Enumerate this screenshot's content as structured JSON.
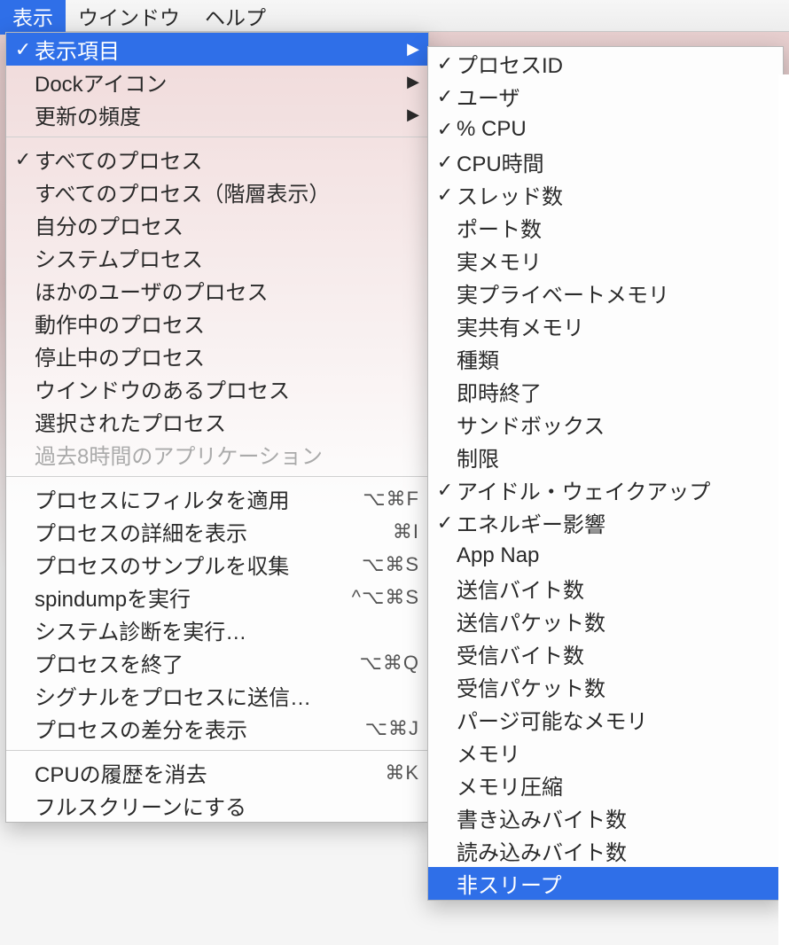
{
  "menubar": {
    "view": "表示",
    "window": "ウインドウ",
    "help": "ヘルプ"
  },
  "main_menu": {
    "columns": "表示項目",
    "dock_icon": "Dockアイコン",
    "update_frequency": "更新の頻度",
    "all_processes": "すべてのプロセス",
    "all_processes_hier": "すべてのプロセス（階層表示）",
    "my_processes": "自分のプロセス",
    "system_processes": "システムプロセス",
    "other_user_processes": "ほかのユーザのプロセス",
    "active_processes": "動作中のプロセス",
    "inactive_processes": "停止中のプロセス",
    "windowed_processes": "ウインドウのあるプロセス",
    "selected_processes": "選択されたプロセス",
    "apps_last_8h": "過去8時間のアプリケーション",
    "filter_processes": "プロセスにフィルタを適用",
    "inspect_process": "プロセスの詳細を表示",
    "sample_process": "プロセスのサンプルを収集",
    "run_spindump": "spindumpを実行",
    "run_sysdiagnose": "システム診断を実行…",
    "quit_process": "プロセスを終了",
    "send_signal": "シグナルをプロセスに送信…",
    "show_deltas": "プロセスの差分を表示",
    "clear_cpu_history": "CPUの履歴を消去",
    "enter_full_screen": "フルスクリーンにする"
  },
  "shortcuts": {
    "filter": "⌥⌘F",
    "inspect": "⌘I",
    "sample": "⌥⌘S",
    "spindump": "^⌥⌘S",
    "quit": "⌥⌘Q",
    "deltas": "⌥⌘J",
    "clear": "⌘K"
  },
  "submenu": {
    "pid": "プロセスID",
    "user": "ユーザ",
    "pct_cpu": "% CPU",
    "cpu_time": "CPU時間",
    "threads": "スレッド数",
    "ports": "ポート数",
    "real_mem": "実メモリ",
    "real_private_mem": "実プライベートメモリ",
    "real_shared_mem": "実共有メモリ",
    "kind": "種類",
    "sudden_term": "即時終了",
    "sandbox": "サンドボックス",
    "restricted": "制限",
    "idle_wake_ups": "アイドル・ウェイクアップ",
    "energy_impact": "エネルギー影響",
    "app_nap": "App Nap",
    "bytes_sent": "送信バイト数",
    "packets_sent": "送信パケット数",
    "bytes_received": "受信バイト数",
    "packets_received": "受信パケット数",
    "pageable_mem": "パージ可能なメモリ",
    "memory": "メモリ",
    "compressed_mem": "メモリ圧縮",
    "bytes_written": "書き込みバイト数",
    "bytes_read": "読み込みバイト数",
    "preventing_sleep": "非スリープ"
  }
}
